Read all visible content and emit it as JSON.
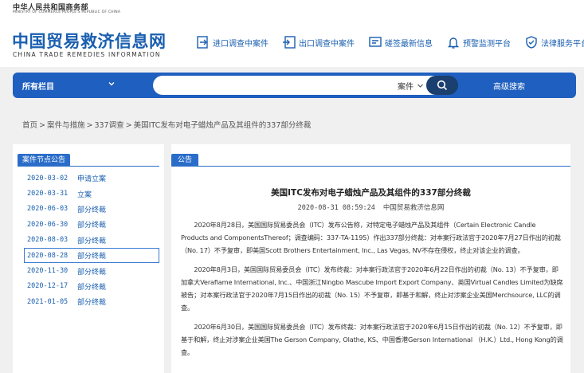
{
  "ministry": {
    "name_cn": "中华人民共和国商务部",
    "name_en": "MINISTRY OF COMMERCE PEOPLE'S REPUBLIC OF CHINA"
  },
  "logo": {
    "title_cn": "中国贸易救济信息网",
    "title_en": "CHINA TRADE REMEDIES INFORMATION"
  },
  "nav": [
    {
      "label": "进口调查中案件",
      "icon": "import-case-icon"
    },
    {
      "label": "出口调查中案件",
      "icon": "export-case-icon"
    },
    {
      "label": "磋签最新信息",
      "icon": "consultation-icon"
    },
    {
      "label": "预警监测平台",
      "icon": "bell-icon"
    },
    {
      "label": "法律服务平台",
      "icon": "shield-icon"
    }
  ],
  "search": {
    "category_label": "所有栏目",
    "placeholder": "",
    "type_label": "案件",
    "advanced_label": "高级搜索"
  },
  "breadcrumb": {
    "home": "首页",
    "level1": "案件与措施",
    "level2": "337调查",
    "current": "美国ITC发布对电子蜡烛产品及其组件的337部分终裁"
  },
  "left_panel": {
    "tag": "案件节点公告",
    "items": [
      {
        "date": "2020-03-02",
        "label": "申请立案"
      },
      {
        "date": "2020-03-31",
        "label": "立案"
      },
      {
        "date": "2020-06-03",
        "label": "部分终裁"
      },
      {
        "date": "2020-06-30",
        "label": "部分终裁"
      },
      {
        "date": "2020-08-03",
        "label": "部分终裁"
      },
      {
        "date": "2020-08-28",
        "label": "部分终裁"
      },
      {
        "date": "2020-11-30",
        "label": "部分终裁"
      },
      {
        "date": "2020-12-17",
        "label": "部分终裁"
      },
      {
        "date": "2021-01-05",
        "label": "部分终裁"
      }
    ]
  },
  "article": {
    "tag": "公告",
    "title": "美国ITC发布对电子蜡烛产品及其组件的337部分终裁",
    "time": "2020-08-31 08:59:24",
    "source": "中国贸易救济信息网",
    "paragraphs": [
      "2020年8月28日，美国国际贸易委员会（ITC）发布公告称，对特定电子蜡烛产品及其组件（Certain Electronic Candle Products and ComponentsThereof；调查编码：337-TA-1195）作出337部分终裁：对本案行政法官于2020年7月27日作出的初裁（No. 17）不予复审，即美国Scott Brothers Entertainment, Inc., Las Vegas, NV不存在侵权，终止对该企业的调查。",
      "2020年8月3日，美国国际贸易委员会（ITC）发布终裁：对本案行政法官于2020年6月22日作出的初裁（No. 13）不予复审，即加拿大Veraflame International, Inc.、中国浙江Ningbo Mascube Import Export Company、英国Virtual Candles Limited为缺席被告；对本案行政法官于2020年7月15日作出的初裁（No. 15）不予复审，即基于和解，终止对涉案企业美国Merchsource, LLC的调查。",
      "2020年6月30日，美国国际贸易委员会（ITC）发布终裁：对本案行政法官于2020年6月15日作出的初裁（No. 12）不予复审，即基于和解，终止对涉案企业美国The Gerson Company, Olathe, KS、中国香港Gerson International （H.K.）Ltd., Hong Kong的调查。"
    ]
  },
  "colors": {
    "brand_blue": "#1a5fb0",
    "bar_blue": "#1f5fbf",
    "tag_blue": "#2a6dc9"
  }
}
